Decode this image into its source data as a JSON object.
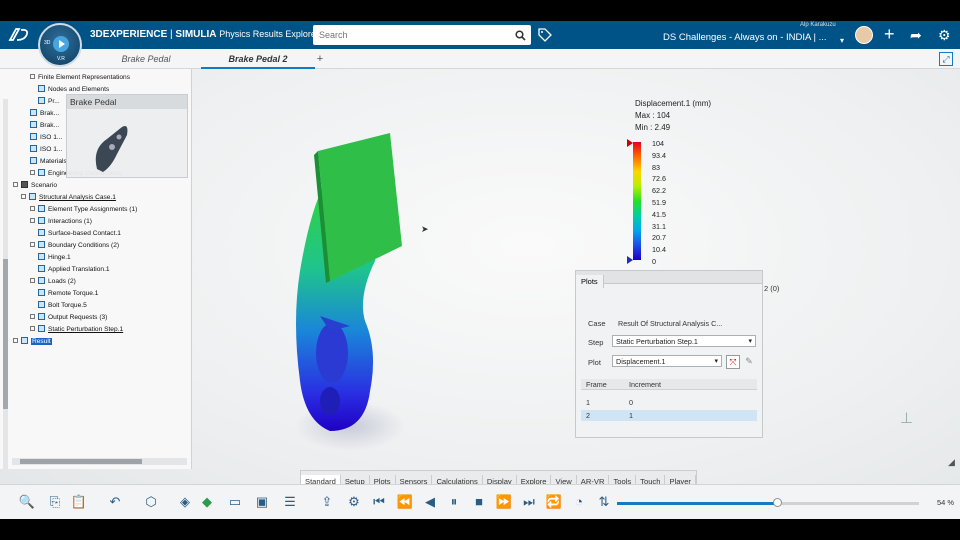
{
  "topbar": {
    "brand_prefix": "3DEXPERIENCE",
    "brand_app": "SIMULIA",
    "brand_role": "Physics Results Explorer",
    "search_placeholder": "Search",
    "user_name": "Alp Karakuzu",
    "collab_space": "DS Challenges - Always on - INDIA | ...",
    "compass_3d": "3D",
    "compass_version": "V.R"
  },
  "tabs": [
    {
      "label": "Brake Pedal"
    },
    {
      "label": "Brake Pedal 2"
    },
    {
      "label": "+"
    }
  ],
  "tree": {
    "preview_title": "Brake Pedal",
    "items": [
      "Finite Element Representations",
      "Nodes and Elements",
      "Pr...",
      "Brak...",
      "Brak...",
      "ISO 1...",
      "ISO 1...",
      "Materials",
      "Engineering Connections",
      "Scenario",
      "Structural Analysis Case.1",
      "Element Type Assignments (1)",
      "Interactions (1)",
      "Surface-based Contact.1",
      "Boundary Conditions (2)",
      "Hinge.1",
      "Applied Translation.1",
      "Loads (2)",
      "Remote Torque.1",
      "Bolt Torque.5",
      "Output Requests (3)",
      "Static Perturbation Step.1",
      "Result"
    ]
  },
  "legend": {
    "title": "Displacement.1 (mm)",
    "max": "Max : 104",
    "min": "Min : 2.49",
    "ticks": [
      "104",
      "93.4",
      "83",
      "72.6",
      "62.2",
      "51.9",
      "41.5",
      "31.1",
      "20.7",
      "10.4",
      "0"
    ]
  },
  "plots": {
    "tab": "Plots",
    "case_label": "Case",
    "case_value": "Result Of Structural Analysis C...",
    "step_label": "Step",
    "step_value": "Static Perturbation Step.1",
    "plot_label": "Plot",
    "plot_value": "Displacement.1",
    "col_frame": "Frame",
    "col_increment": "Increment",
    "rows": [
      {
        "frame": "1",
        "increment": "0"
      },
      {
        "frame": "2",
        "increment": "1"
      }
    ],
    "behind_text": "2 (0)"
  },
  "section_tabs": [
    "Standard",
    "Setup",
    "Plots",
    "Sensors",
    "Calculations",
    "Display",
    "Explore",
    "View",
    "AR-VR",
    "Tools",
    "Touch",
    "Player"
  ],
  "player": {
    "zoom": "54 %",
    "progress": 0.53
  },
  "colors": {
    "topbar": "#005386",
    "accent": "#1679c4"
  },
  "icons": [
    "ds-logo-icon",
    "search-icon",
    "tag-icon",
    "avatar",
    "plus-icon",
    "share-icon",
    "community-icon",
    "expand-icon",
    "compass-play-icon"
  ]
}
